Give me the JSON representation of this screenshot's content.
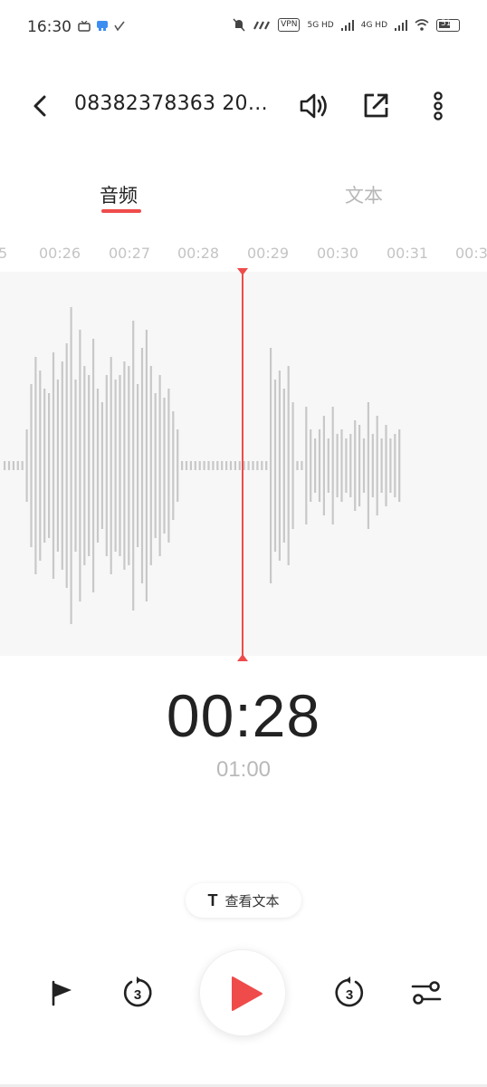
{
  "status_bar": {
    "time": "16:30",
    "vpn": "VPN",
    "battery": "51",
    "network_1": "5G HD",
    "network_2": "4G HD"
  },
  "header": {
    "title": "08382378363 20…"
  },
  "tabs": [
    {
      "label": "音频",
      "active": true
    },
    {
      "label": "文本",
      "active": false
    }
  ],
  "timeline": {
    "ticks": [
      "5",
      "00:26",
      "00:27",
      "00:28",
      "00:29",
      "00:30",
      "00:31",
      "00:3"
    ]
  },
  "playback": {
    "current_time": "00:28",
    "total_time": "01:00"
  },
  "view_text_button": {
    "label": "查看文本"
  },
  "controls": {
    "skip_back_seconds": "3",
    "skip_forward_seconds": "3"
  },
  "colors": {
    "accent": "#ef4b4b",
    "wave": "#c8c8c8",
    "wave_bg": "#f7f7f7"
  }
}
